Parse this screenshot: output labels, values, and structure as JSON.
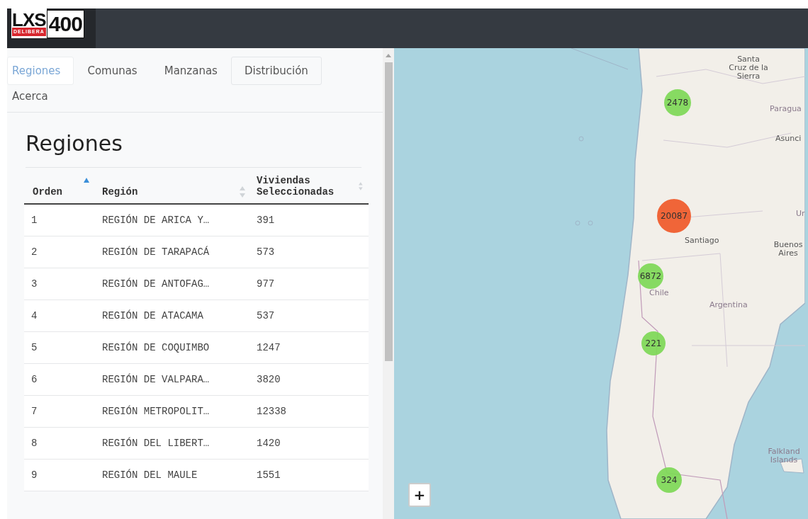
{
  "logo": {
    "top": "LXS",
    "sub": "DELIBERA",
    "number": "400"
  },
  "tabs": [
    {
      "label": "Regiones",
      "selected": true,
      "hovered": false
    },
    {
      "label": "Comunas",
      "selected": false,
      "hovered": false
    },
    {
      "label": "Manzanas",
      "selected": false,
      "hovered": false
    },
    {
      "label": "Distribución",
      "selected": false,
      "hovered": true
    },
    {
      "label": "Acerca",
      "selected": false,
      "hovered": false
    }
  ],
  "heading": "Regiones",
  "table": {
    "columns": [
      {
        "label": "Orden",
        "sorted": true
      },
      {
        "label": "Región",
        "sorted": false
      },
      {
        "label": "Viviendas Seleccionadas",
        "sorted": false
      }
    ],
    "rows": [
      [
        "1",
        "REGIÓN DE ARICA Y…",
        "391"
      ],
      [
        "2",
        "REGIÓN DE TARAPACÁ",
        "573"
      ],
      [
        "3",
        "REGIÓN DE ANTOFAG…",
        "977"
      ],
      [
        "4",
        "REGIÓN DE ATACAMA",
        "537"
      ],
      [
        "5",
        "REGIÓN DE COQUIMBO",
        "1247"
      ],
      [
        "6",
        "REGIÓN DE VALPARA…",
        "3820"
      ],
      [
        "7",
        "REGIÓN METROPOLIT…",
        "12338"
      ],
      [
        "8",
        "REGIÓN DEL LIBERT…",
        "1420"
      ],
      [
        "9",
        "REGIÓN DEL MAULE",
        "1551"
      ]
    ]
  },
  "map": {
    "labels": [
      {
        "text": "Santa Cruz de la Sierra",
        "kind": "city"
      },
      {
        "text": "Paragua",
        "kind": "country"
      },
      {
        "text": "Asunci",
        "kind": "city"
      },
      {
        "text": "Ur",
        "kind": "country"
      },
      {
        "text": "Buenos Aires",
        "kind": "city"
      },
      {
        "text": "Santiago",
        "kind": "city"
      },
      {
        "text": "Chile",
        "kind": "country"
      },
      {
        "text": "Argentina",
        "kind": "country"
      },
      {
        "text": "Falkland Islands",
        "kind": "country"
      }
    ],
    "clusters": [
      {
        "count": "2478",
        "color": "#7ed957"
      },
      {
        "count": "20087",
        "color": "#f05a2a"
      },
      {
        "count": "6872",
        "color": "#7ed957"
      },
      {
        "count": "221",
        "color": "#7ed957"
      },
      {
        "count": "324",
        "color": "#7ed957"
      }
    ],
    "zoom_in": "+"
  }
}
